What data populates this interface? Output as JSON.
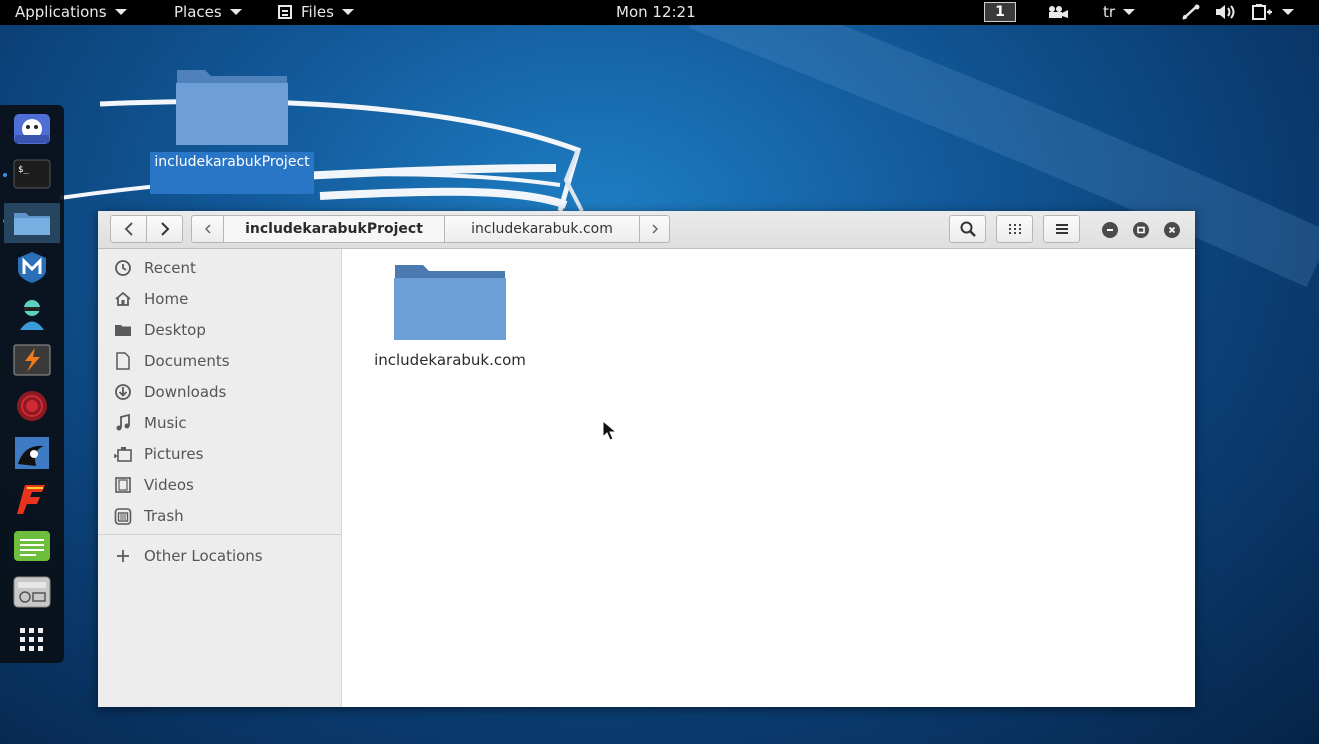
{
  "topbar": {
    "applications": "Applications",
    "places": "Places",
    "files": "Files",
    "clock": "Mon 12:21",
    "workspace": "1",
    "keyboard_layout": "tr"
  },
  "dock": {
    "items": [
      "app-icon",
      "terminal-icon",
      "files-icon",
      "metasploit-icon",
      "armitage-icon",
      "burpsuite-icon",
      "faraday-icon",
      "kali-icon",
      "freemind-icon",
      "text-editor-icon",
      "keyboard-icon",
      "show-apps-icon"
    ]
  },
  "desktop": {
    "folder_label": "includekarabukProject"
  },
  "window": {
    "path": {
      "current": "includekarabukProject",
      "next": "includekarabuk.com"
    },
    "sidebar": {
      "items": [
        {
          "label": "Recent",
          "icon": "clock-icon"
        },
        {
          "label": "Home",
          "icon": "home-icon"
        },
        {
          "label": "Desktop",
          "icon": "desktop-icon"
        },
        {
          "label": "Documents",
          "icon": "document-icon"
        },
        {
          "label": "Downloads",
          "icon": "download-icon"
        },
        {
          "label": "Music",
          "icon": "music-icon"
        },
        {
          "label": "Pictures",
          "icon": "pictures-icon"
        },
        {
          "label": "Videos",
          "icon": "video-icon"
        },
        {
          "label": "Trash",
          "icon": "trash-icon"
        }
      ],
      "other_locations": "Other Locations"
    },
    "files": [
      {
        "name": "includekarabuk.com",
        "type": "folder"
      }
    ]
  },
  "colors": {
    "accent": "#2a76c6",
    "folder": "#6a9fd6",
    "topbar": "#000000"
  }
}
